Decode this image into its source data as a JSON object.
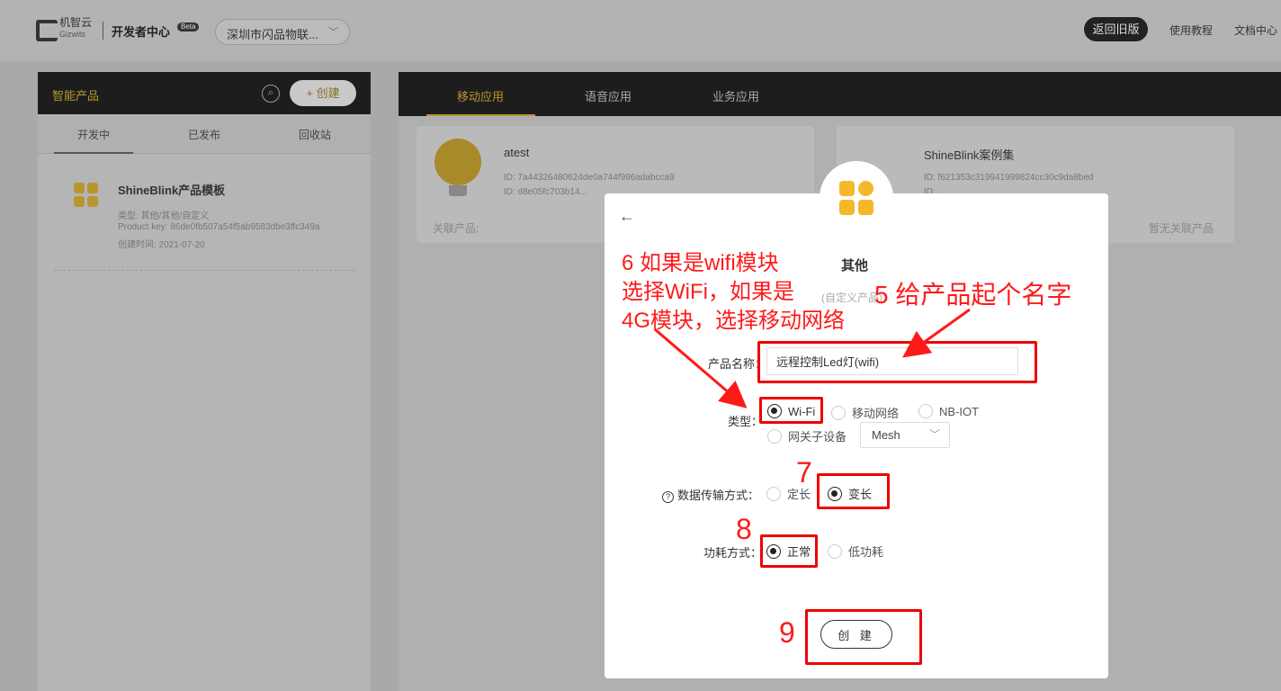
{
  "header": {
    "logo_text": "机智云",
    "logo_en": "Gizwits",
    "dev_center": "开发者中心",
    "beta": "Beta",
    "org_select": "深圳市闪品物联...",
    "back_old": "返回旧版",
    "tutorial": "使用教程",
    "docs": "文档中心"
  },
  "sidebar": {
    "title": "智能产品",
    "create_label": "+ 创建",
    "tabs": [
      "开发中",
      "已发布",
      "回收站"
    ],
    "product": {
      "name": "ShineBlink产品模板",
      "type": "类型: 其他/其他/自定义",
      "product_key": "Product key: 86de0fb507a54f5ab9583dbe3ffc349a",
      "created": "创建时间: 2021-07-20"
    }
  },
  "main": {
    "tabs": [
      "移动应用",
      "语音应用",
      "业务应用"
    ],
    "cards": [
      {
        "name": "atest",
        "id1": "ID: 7a44326480624de0a744f996adabcca9",
        "id2": "ID: d8e05fc703b14...",
        "footer": "关联产品:"
      },
      {
        "name": "ShineBlink案例集",
        "id1": "ID: f621353c319941999824cc30c9da8bed",
        "id2": "ID: ...",
        "footer": "暂无关联产品"
      }
    ]
  },
  "modal": {
    "title": "其他",
    "subtitle": "(自定义产品)",
    "name_label": "产品名称：",
    "name_value": "远程控制Led灯(wifi)",
    "type_label": "类型：",
    "type_options": [
      "Wi-Fi",
      "移动网络",
      "NB-IOT",
      "网关子设备"
    ],
    "type_selected": "Wi-Fi",
    "mesh_value": "Mesh",
    "transfer_label": "数据传输方式：",
    "transfer_options": [
      "定长",
      "变长"
    ],
    "transfer_selected": "变长",
    "power_label": "功耗方式：",
    "power_options": [
      "正常",
      "低功耗"
    ],
    "power_selected": "正常",
    "create_button": "创 建"
  },
  "annotations": {
    "step6": [
      "6 如果是wifi模块",
      "选择WiFi，如果是",
      "4G模块，选择移动网络"
    ],
    "step5": "5 给产品起个名字",
    "step7": "7",
    "step8": "8",
    "step9": "9",
    "color": "#ff1a1a"
  }
}
